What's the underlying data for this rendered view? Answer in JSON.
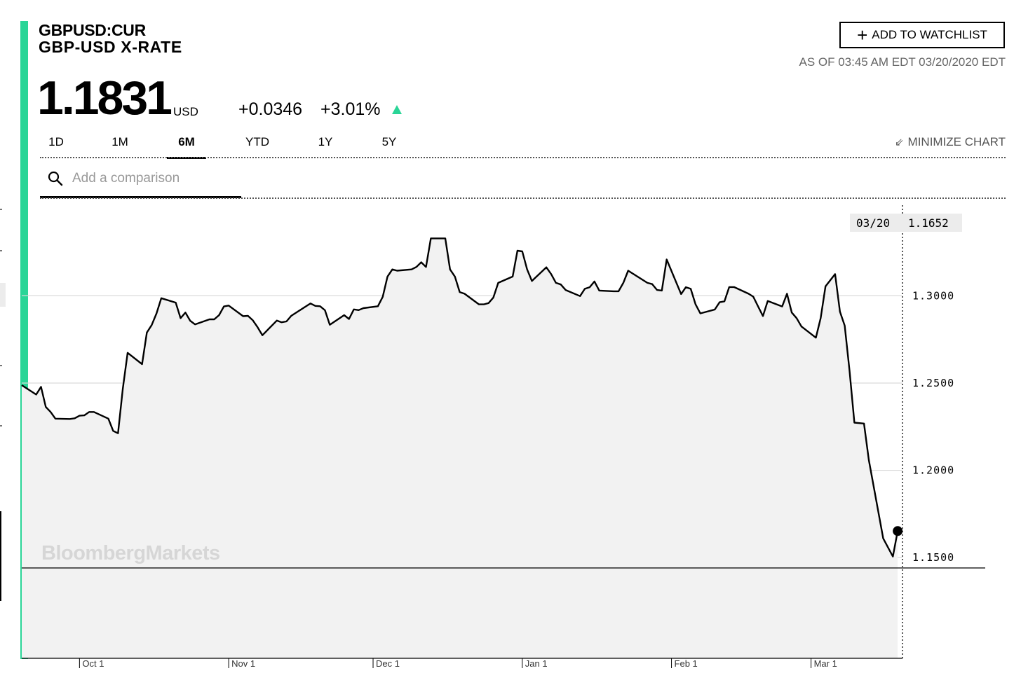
{
  "header": {
    "ticker": "GBPUSD:CUR",
    "name": "GBP-USD X-RATE",
    "price": "1.1831",
    "currency": "USD",
    "change": "+0.0346",
    "change_pct": "+3.01%",
    "as_of": "AS OF 03:45 AM EDT 03/20/2020 EDT",
    "watchlist_label": "ADD TO WATCHLIST"
  },
  "colors": {
    "accent": "#2ad597",
    "line": "#000000",
    "area": "#f2f2f2",
    "grid": "#d9d9d9"
  },
  "tabs": [
    {
      "label": "1D",
      "active": false
    },
    {
      "label": "1M",
      "active": false
    },
    {
      "label": "6M",
      "active": true
    },
    {
      "label": "YTD",
      "active": false
    },
    {
      "label": "1Y",
      "active": false
    },
    {
      "label": "5Y",
      "active": false
    }
  ],
  "minimize_label": "MINIMIZE CHART",
  "compare": {
    "placeholder": "Add a comparison"
  },
  "icons": {
    "search": "search-icon",
    "plus": "plus-icon",
    "minimize": "minimize-icon",
    "up_arrow": "up-triangle-icon"
  },
  "watermark": "BloombergMarkets",
  "chart_data": {
    "type": "line",
    "x_axis": "date",
    "xlim": [
      "2019-09-19",
      "2020-03-20"
    ],
    "ylim": [
      1.0923,
      1.3519
    ],
    "y_ticks": [
      1.15,
      1.2,
      1.25,
      1.3
    ],
    "y_tick_labels": [
      "1.1500",
      "1.2000",
      "1.2500",
      "1.3000"
    ],
    "x_ticks": [
      "2019-10-01",
      "2019-11-01",
      "2019-12-01",
      "2020-01-01",
      "2020-02-01",
      "2020-03-01"
    ],
    "x_tick_labels": [
      "Oct 1",
      "Nov 1",
      "Dec 1",
      "Jan 1",
      "Feb 1",
      "Mar 1"
    ],
    "grid": true,
    "hover": {
      "date": "03/20",
      "value": "1.1652"
    },
    "series": [
      {
        "points": [
          [
            "2019-09-19",
            1.2488
          ],
          [
            "2019-09-22",
            1.2434
          ],
          [
            "2019-09-23",
            1.2478
          ],
          [
            "2019-09-24",
            1.2363
          ],
          [
            "2019-09-25",
            1.2334
          ],
          [
            "2019-09-26",
            1.2296
          ],
          [
            "2019-09-29",
            1.2294
          ],
          [
            "2019-09-30",
            1.2298
          ],
          [
            "2019-10-01",
            1.2313
          ],
          [
            "2019-10-02",
            1.2315
          ],
          [
            "2019-10-03",
            1.2334
          ],
          [
            "2019-10-04",
            1.2334
          ],
          [
            "2019-10-07",
            1.2296
          ],
          [
            "2019-10-08",
            1.2226
          ],
          [
            "2019-10-09",
            1.2212
          ],
          [
            "2019-10-10",
            1.2467
          ],
          [
            "2019-10-11",
            1.2673
          ],
          [
            "2019-10-14",
            1.2608
          ],
          [
            "2019-10-15",
            1.2789
          ],
          [
            "2019-10-16",
            1.2832
          ],
          [
            "2019-10-17",
            1.2899
          ],
          [
            "2019-10-18",
            1.2986
          ],
          [
            "2019-10-21",
            1.2961
          ],
          [
            "2019-10-22",
            1.2872
          ],
          [
            "2019-10-23",
            1.2904
          ],
          [
            "2019-10-24",
            1.2857
          ],
          [
            "2019-10-25",
            1.2836
          ],
          [
            "2019-10-28",
            1.2865
          ],
          [
            "2019-10-29",
            1.2865
          ],
          [
            "2019-10-30",
            1.2889
          ],
          [
            "2019-10-31",
            1.2939
          ],
          [
            "2019-11-01",
            1.2944
          ],
          [
            "2019-11-04",
            1.2883
          ],
          [
            "2019-11-05",
            1.2885
          ],
          [
            "2019-11-06",
            1.286
          ],
          [
            "2019-11-07",
            1.282
          ],
          [
            "2019-11-08",
            1.2774
          ],
          [
            "2019-11-11",
            1.2858
          ],
          [
            "2019-11-12",
            1.2848
          ],
          [
            "2019-11-13",
            1.2853
          ],
          [
            "2019-11-14",
            1.2885
          ],
          [
            "2019-11-15",
            1.2903
          ],
          [
            "2019-11-18",
            1.2956
          ],
          [
            "2019-11-19",
            1.2942
          ],
          [
            "2019-11-20",
            1.294
          ],
          [
            "2019-11-21",
            1.2917
          ],
          [
            "2019-11-22",
            1.2834
          ],
          [
            "2019-11-25",
            1.2889
          ],
          [
            "2019-11-26",
            1.2867
          ],
          [
            "2019-11-27",
            1.2922
          ],
          [
            "2019-11-28",
            1.2918
          ],
          [
            "2019-11-29",
            1.2929
          ],
          [
            "2019-12-02",
            1.294
          ],
          [
            "2019-12-03",
            1.2994
          ],
          [
            "2019-12-04",
            1.311
          ],
          [
            "2019-12-05",
            1.3151
          ],
          [
            "2019-12-06",
            1.3144
          ],
          [
            "2019-12-09",
            1.3151
          ],
          [
            "2019-12-10",
            1.3165
          ],
          [
            "2019-12-11",
            1.3192
          ],
          [
            "2019-12-12",
            1.3165
          ],
          [
            "2019-12-13",
            1.3329
          ],
          [
            "2019-12-16",
            1.3329
          ],
          [
            "2019-12-17",
            1.3151
          ],
          [
            "2019-12-18",
            1.311
          ],
          [
            "2019-12-19",
            1.3021
          ],
          [
            "2019-12-20",
            1.3012
          ],
          [
            "2019-12-23",
            1.2951
          ],
          [
            "2019-12-24",
            1.2951
          ],
          [
            "2019-12-25",
            1.2958
          ],
          [
            "2019-12-26",
            1.299
          ],
          [
            "2019-12-27",
            1.3074
          ],
          [
            "2019-12-30",
            1.311
          ],
          [
            "2019-12-31",
            1.3258
          ],
          [
            "2020-01-01",
            1.3254
          ],
          [
            "2020-01-02",
            1.3151
          ],
          [
            "2020-01-03",
            1.3085
          ],
          [
            "2020-01-06",
            1.3163
          ],
          [
            "2020-01-07",
            1.3124
          ],
          [
            "2020-01-08",
            1.3074
          ],
          [
            "2020-01-09",
            1.3065
          ],
          [
            "2020-01-10",
            1.3033
          ],
          [
            "2020-01-13",
            1.2998
          ],
          [
            "2020-01-14",
            1.304
          ],
          [
            "2020-01-15",
            1.3049
          ],
          [
            "2020-01-16",
            1.3082
          ],
          [
            "2020-01-17",
            1.303
          ],
          [
            "2020-01-20",
            1.3026
          ],
          [
            "2020-01-21",
            1.3026
          ],
          [
            "2020-01-22",
            1.3074
          ],
          [
            "2020-01-23",
            1.3144
          ],
          [
            "2020-01-24",
            1.3126
          ],
          [
            "2020-01-27",
            1.3074
          ],
          [
            "2020-01-28",
            1.3067
          ],
          [
            "2020-01-29",
            1.3033
          ],
          [
            "2020-01-30",
            1.303
          ],
          [
            "2020-01-31",
            1.3208
          ],
          [
            "2020-02-03",
            1.301
          ],
          [
            "2020-02-04",
            1.3049
          ],
          [
            "2020-02-05",
            1.304
          ],
          [
            "2020-02-06",
            1.2951
          ],
          [
            "2020-02-07",
            1.2899
          ],
          [
            "2020-02-10",
            1.2921
          ],
          [
            "2020-02-11",
            1.2963
          ],
          [
            "2020-02-12",
            1.2968
          ],
          [
            "2020-02-13",
            1.305
          ],
          [
            "2020-02-14",
            1.305
          ],
          [
            "2020-02-17",
            1.3012
          ],
          [
            "2020-02-18",
            1.2995
          ],
          [
            "2020-02-19",
            1.2939
          ],
          [
            "2020-02-20",
            1.2884
          ],
          [
            "2020-02-21",
            1.297
          ],
          [
            "2020-02-24",
            1.2939
          ],
          [
            "2020-02-25",
            1.3012
          ],
          [
            "2020-02-26",
            1.2904
          ],
          [
            "2020-02-27",
            1.2872
          ],
          [
            "2020-02-28",
            1.2824
          ],
          [
            "2020-03-02",
            1.276
          ],
          [
            "2020-03-03",
            1.2872
          ],
          [
            "2020-03-04",
            1.3054
          ],
          [
            "2020-03-06",
            1.3124
          ],
          [
            "2020-03-07",
            1.2909
          ],
          [
            "2020-03-08",
            1.2829
          ],
          [
            "2020-03-09",
            1.257
          ],
          [
            "2020-03-10",
            1.2273
          ],
          [
            "2020-03-12",
            1.2268
          ],
          [
            "2020-03-13",
            1.2059
          ],
          [
            "2020-03-16",
            1.161
          ],
          [
            "2020-03-18",
            1.1506
          ],
          [
            "2020-03-19",
            1.1652
          ]
        ]
      }
    ]
  }
}
